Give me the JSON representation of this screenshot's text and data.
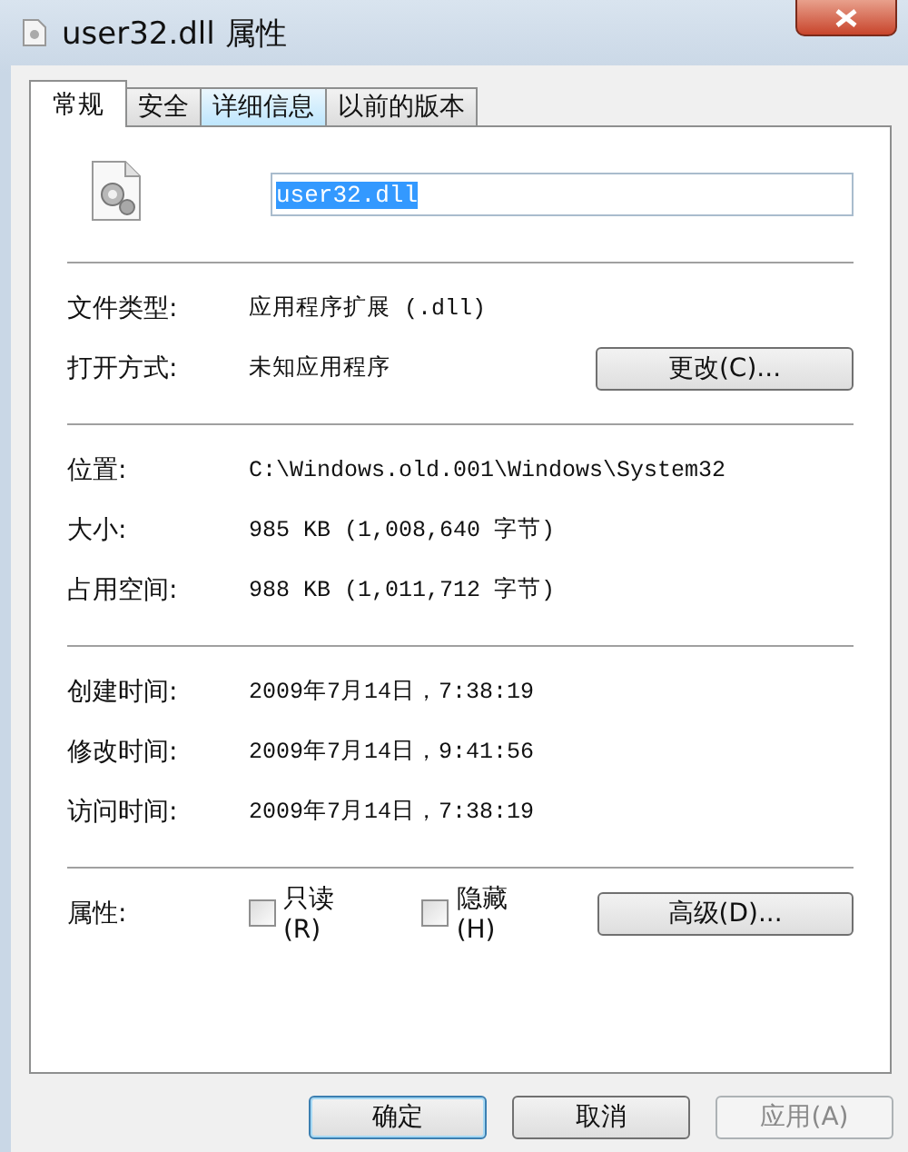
{
  "window": {
    "title": "user32.dll 属性"
  },
  "tabs": [
    {
      "label": "常规",
      "selected": true,
      "highlighted": false
    },
    {
      "label": "安全",
      "selected": false,
      "highlighted": false
    },
    {
      "label": "详细信息",
      "selected": false,
      "highlighted": true
    },
    {
      "label": "以前的版本",
      "selected": false,
      "highlighted": false
    }
  ],
  "file_name": {
    "value": "user32.dll",
    "highlighted": true
  },
  "sections": [
    [
      {
        "label": "文件类型:",
        "value": "应用程序扩展 (.dll)"
      },
      {
        "label": "打开方式:",
        "value": "未知应用程序",
        "button": "更改(C)..."
      }
    ],
    [
      {
        "label": "位置:",
        "value": "C:\\Windows.old.001\\Windows\\System32"
      },
      {
        "label": "大小:",
        "value": "985 KB (1,008,640 字节)"
      },
      {
        "label": "占用空间:",
        "value": "988 KB (1,011,712 字节)"
      }
    ],
    [
      {
        "label": "创建时间:",
        "value": "2009年7月14日，7:38:19"
      },
      {
        "label": "修改时间:",
        "value": "2009年7月14日，9:41:56"
      },
      {
        "label": "访问时间:",
        "value": "2009年7月14日，7:38:19"
      }
    ]
  ],
  "attributes": {
    "label": "属性:",
    "checkboxes": [
      {
        "label": "只读(R)",
        "checked": false
      },
      {
        "label": "隐藏(H)",
        "checked": false
      }
    ],
    "button": "高级(D)..."
  },
  "buttons": [
    {
      "label": "确定",
      "default": true,
      "disabled": false
    },
    {
      "label": "取消",
      "default": false,
      "disabled": false
    },
    {
      "label": "应用(A)",
      "default": false,
      "disabled": true
    }
  ]
}
